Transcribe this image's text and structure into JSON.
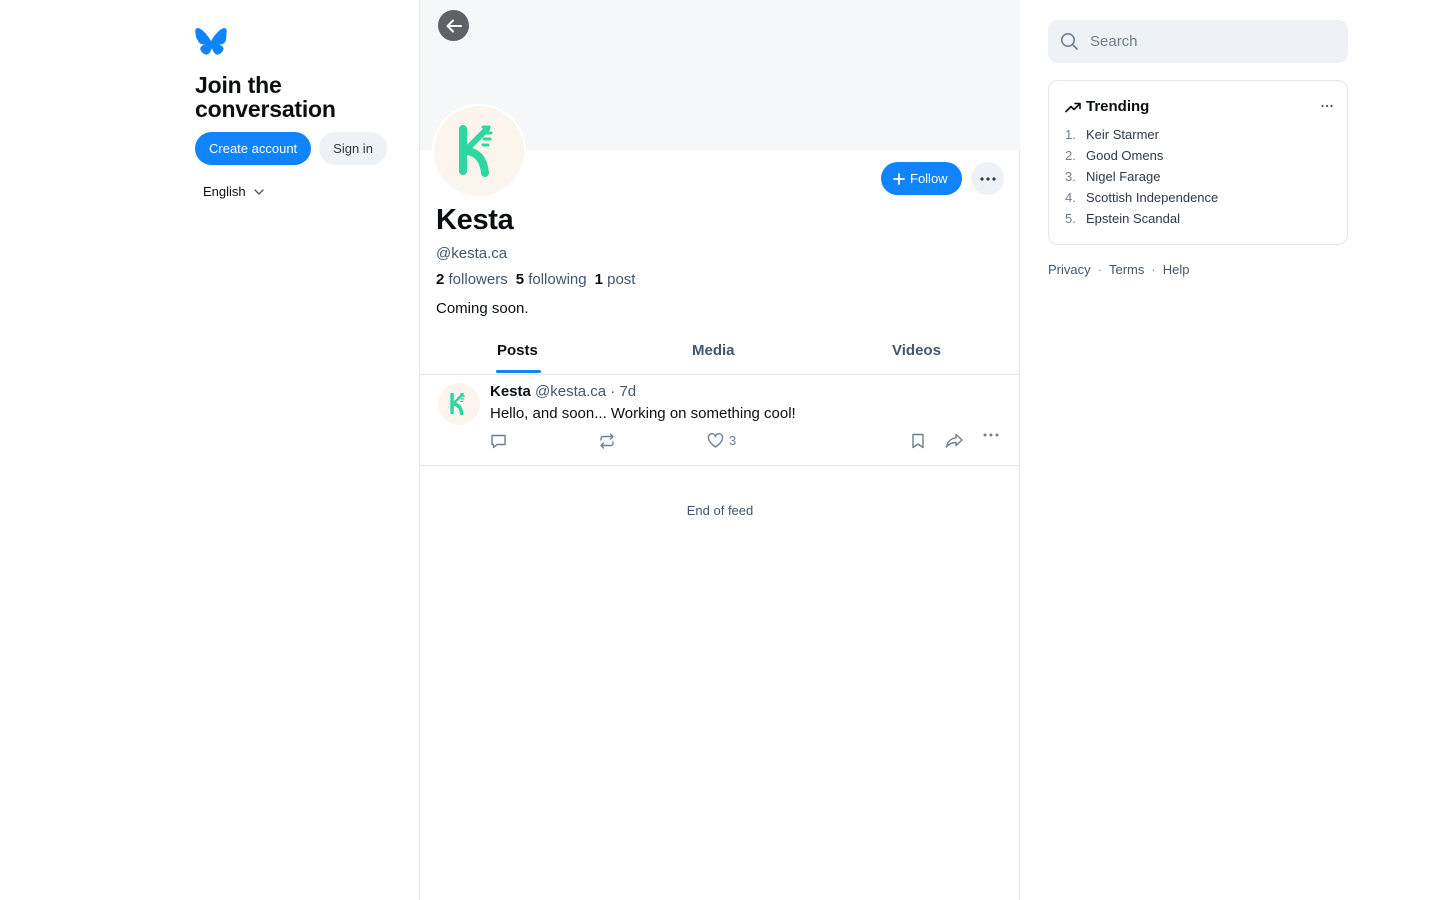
{
  "sidebar": {
    "join_title": "Join the conversation",
    "create_account_label": "Create account",
    "sign_in_label": "Sign in",
    "language_label": "English"
  },
  "profile": {
    "display_name": "Kesta",
    "handle": "@kesta.ca",
    "followers_count": "2",
    "followers_label": "followers",
    "following_count": "5",
    "following_label": "following",
    "posts_count": "1",
    "posts_label": "post",
    "bio": "Coming soon.",
    "follow_label": "Follow",
    "avatar_letter": "K"
  },
  "tabs": [
    {
      "label": "Posts",
      "active": true
    },
    {
      "label": "Media",
      "active": false
    },
    {
      "label": "Videos",
      "active": false
    }
  ],
  "post": {
    "author": "Kesta",
    "handle": "@kesta.ca",
    "time": "· 7d",
    "text": "Hello, and soon... Working on something cool!",
    "like_count": "3"
  },
  "feed": {
    "end_label": "End of feed"
  },
  "search": {
    "placeholder": "Search"
  },
  "trending": {
    "title": "Trending",
    "items": [
      {
        "num": "1.",
        "label": "Keir Starmer"
      },
      {
        "num": "2.",
        "label": "Good Omens"
      },
      {
        "num": "3.",
        "label": "Nigel Farage"
      },
      {
        "num": "4.",
        "label": "Scottish Independence"
      },
      {
        "num": "5.",
        "label": "Epstein Scandal"
      }
    ]
  },
  "footer": {
    "privacy": "Privacy",
    "terms": "Terms",
    "help": "Help",
    "separator": "·"
  },
  "colors": {
    "accent": "#1083fe",
    "avatar_green": "#2ed6a0",
    "muted_text": "#42576c"
  },
  "icons": [
    "butterfly-logo-icon",
    "chevron-down-icon",
    "arrow-left-icon",
    "plus-icon",
    "ellipsis-icon",
    "reply-icon",
    "repost-icon",
    "heart-icon",
    "bookmark-icon",
    "share-icon",
    "search-icon",
    "trending-arrow-icon"
  ]
}
